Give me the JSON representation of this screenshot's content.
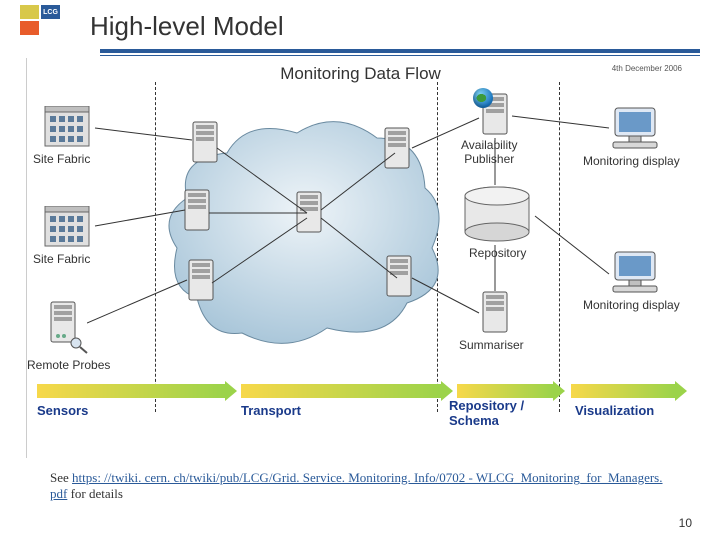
{
  "logo_text": "LCG",
  "title": "High-level Model",
  "diagram": {
    "title": "Monitoring Data Flow",
    "date": "4th December 2006",
    "labels": {
      "site_fabric_1": "Site Fabric",
      "site_fabric_2": "Site Fabric",
      "remote_probes": "Remote Probes",
      "availability_publisher": "Availability\nPublisher",
      "repository": "Repository",
      "summariser": "Summariser",
      "monitoring_display_1": "Monitoring display",
      "monitoring_display_2": "Monitoring display"
    },
    "stages": {
      "sensors": "Sensors",
      "transport": "Transport",
      "repository_schema": "Repository /\nSchema",
      "visualization": "Visualization"
    }
  },
  "footer": {
    "see": "See ",
    "link": "https: //twiki. cern. ch/twiki/pub/LCG/Grid. Service. Monitoring. Info/0702 - WLCG_Monitoring_for_Managers. pdf",
    "suffix": " for details"
  },
  "page_number": "10"
}
